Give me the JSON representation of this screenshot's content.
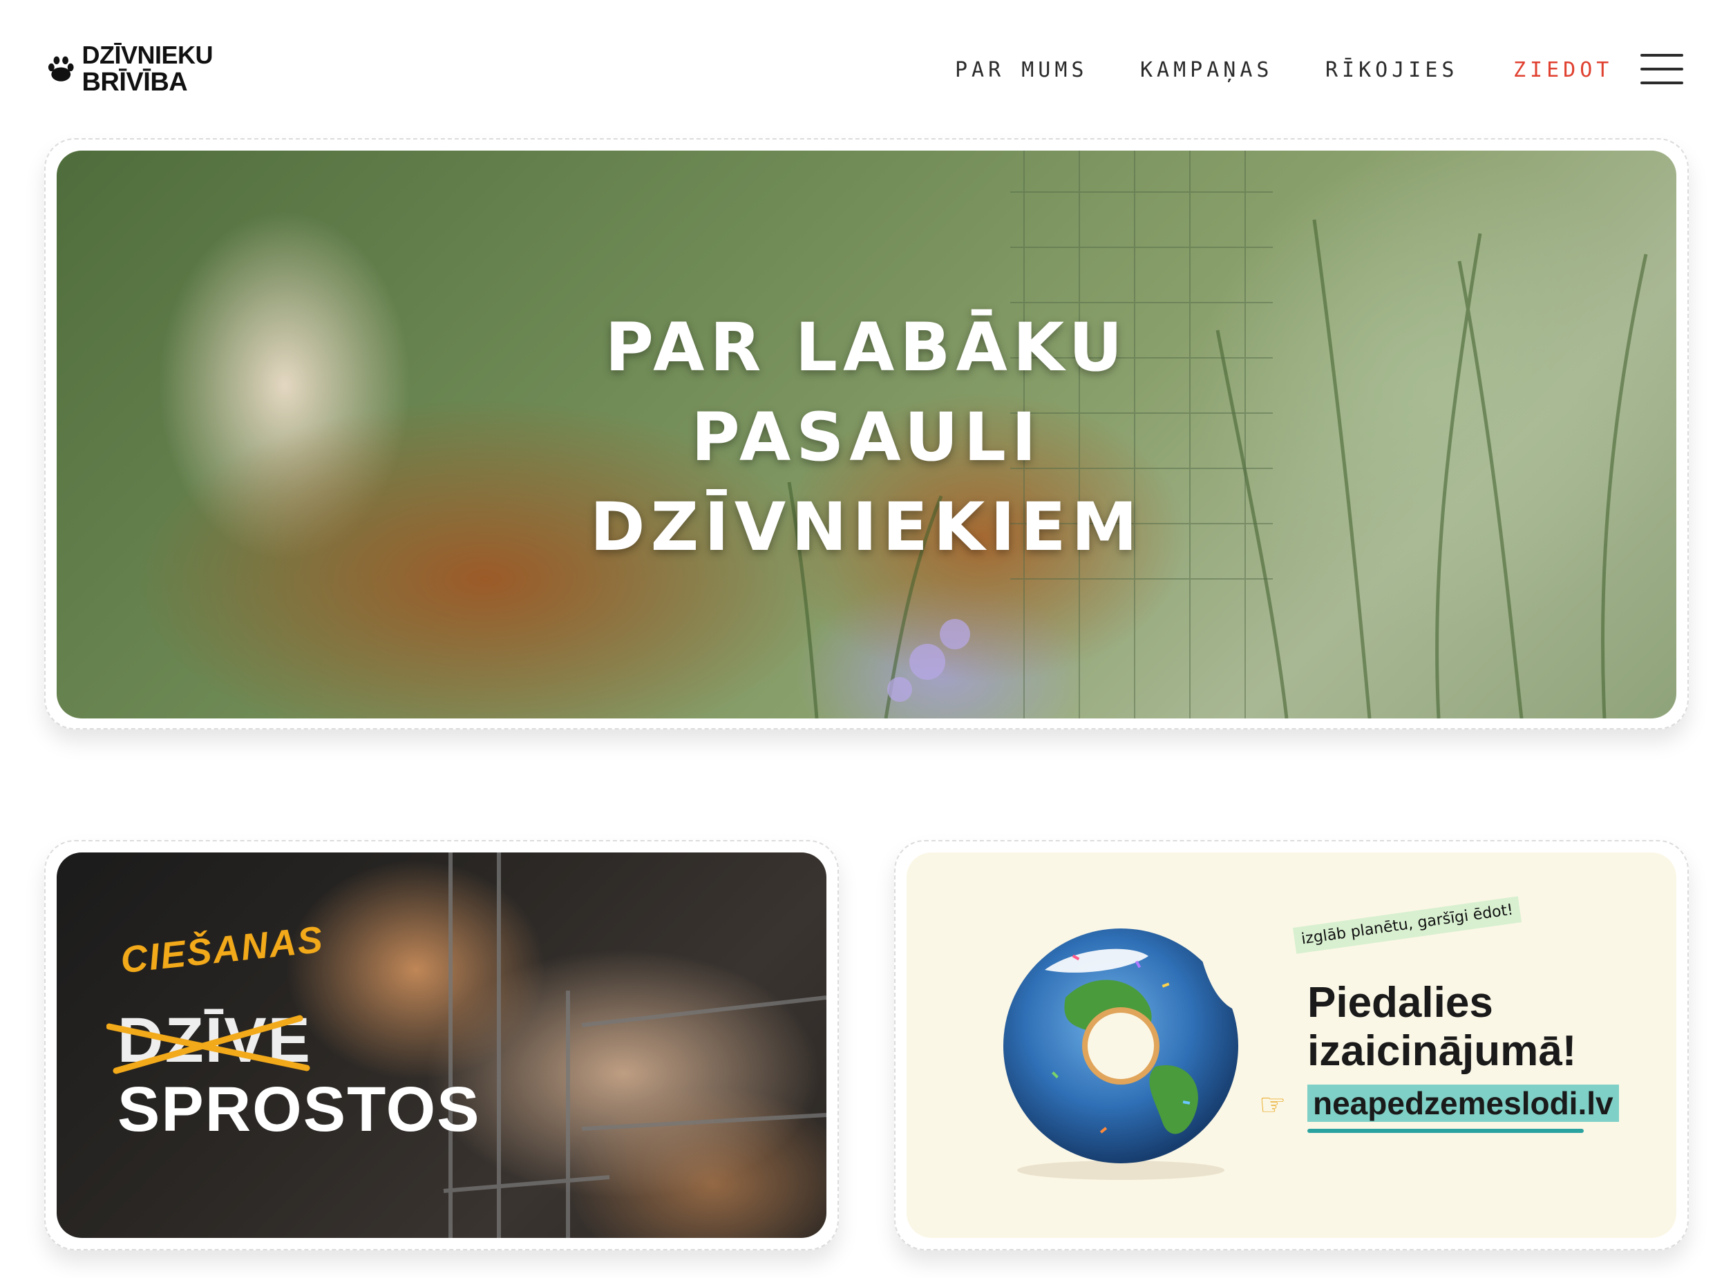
{
  "brand": {
    "line1": "DZĪVNIEKU",
    "line2": "BRĪVĪBA"
  },
  "nav": {
    "items": [
      "PAR MUMS",
      "KAMPAŅAS",
      "RĪKOJIES"
    ],
    "donate": "ZIEDOT",
    "menu_icon": "hamburger-menu-icon"
  },
  "hero": {
    "title_lines": [
      "PAR LABĀKU",
      "PASAULI",
      "DZĪVNIEKIEM"
    ]
  },
  "promo_left": {
    "handwritten": "CIEŠANAS",
    "crossed": "DZĪVE",
    "bottom": "SPROSTOS"
  },
  "promo_right": {
    "tagline": "izglāb planētu, garšīgi ēdot!",
    "headline_line1": "Piedalies",
    "headline_line2": "izaicinājumā!",
    "link": "neapedzemeslodi.lv"
  },
  "colors": {
    "accent_red": "#e0402f",
    "text_dark": "#2b2b2b",
    "teal_highlight": "#7fd0c6",
    "cream": "#fbf7e6",
    "handwriting_orange": "#f2a91a"
  }
}
